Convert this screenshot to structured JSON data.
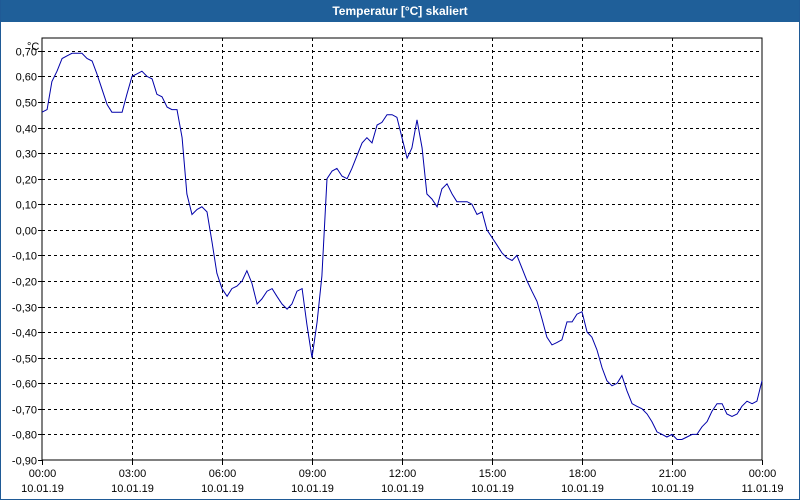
{
  "window": {
    "title": "Temperatur [°C] skaliert"
  },
  "chart_data": {
    "type": "line",
    "title": "Temperatur [°C] skaliert",
    "ylabel": "°C",
    "xlabel": "",
    "ylim": [
      -0.9,
      0.75
    ],
    "xlim": [
      0,
      24
    ],
    "grid": true,
    "y_ticks": [
      "0,70",
      "0,60",
      "0,50",
      "0,40",
      "0,30",
      "0,20",
      "0,10",
      "0,00",
      "-0,10",
      "-0,20",
      "-0,30",
      "-0,40",
      "-0,50",
      "-0,60",
      "-0,70",
      "-0,80",
      "-0,90"
    ],
    "y_tick_values": [
      0.7,
      0.6,
      0.5,
      0.4,
      0.3,
      0.2,
      0.1,
      0.0,
      -0.1,
      -0.2,
      -0.3,
      -0.4,
      -0.5,
      -0.6,
      -0.7,
      -0.8,
      -0.9
    ],
    "x_ticks": [
      {
        "time": "00:00",
        "date": "10.01.19"
      },
      {
        "time": "03:00",
        "date": "10.01.19"
      },
      {
        "time": "06:00",
        "date": "10.01.19"
      },
      {
        "time": "09:00",
        "date": "10.01.19"
      },
      {
        "time": "12:00",
        "date": "10.01.19"
      },
      {
        "time": "15:00",
        "date": "10.01.19"
      },
      {
        "time": "18:00",
        "date": "10.01.19"
      },
      {
        "time": "21:00",
        "date": "10.01.19"
      },
      {
        "time": "00:00",
        "date": "11.01.19"
      }
    ],
    "x_tick_hours": [
      0,
      3,
      6,
      9,
      12,
      15,
      18,
      21,
      24
    ],
    "colors": {
      "line": "#0000aa",
      "grid": "#000000",
      "axis": "#000000"
    },
    "series": [
      {
        "x": [
          0.0,
          0.17,
          0.33,
          0.5,
          0.67,
          0.83,
          1.0,
          1.17,
          1.33,
          1.5,
          1.67,
          1.83,
          2.0,
          2.17,
          2.33,
          2.5,
          2.67,
          2.83,
          3.0,
          3.17,
          3.33,
          3.5,
          3.67,
          3.83,
          4.0,
          4.17,
          4.33,
          4.5,
          4.67,
          4.83,
          5.0,
          5.17,
          5.33,
          5.5,
          5.67,
          5.83,
          6.0,
          6.17,
          6.33,
          6.5,
          6.67,
          6.83,
          7.0,
          7.17,
          7.33,
          7.5,
          7.67,
          7.83,
          8.0,
          8.17,
          8.33,
          8.5,
          8.67,
          8.83,
          9.0,
          9.17,
          9.33,
          9.5,
          9.67,
          9.83,
          10.0,
          10.17,
          10.33,
          10.5,
          10.67,
          10.83,
          11.0,
          11.17,
          11.33,
          11.5,
          11.67,
          11.83,
          12.0,
          12.17,
          12.33,
          12.5,
          12.67,
          12.83,
          13.0,
          13.17,
          13.33,
          13.5,
          13.67,
          13.83,
          14.0,
          14.17,
          14.33,
          14.5,
          14.67,
          14.83,
          15.0,
          15.17,
          15.33,
          15.5,
          15.67,
          15.83,
          16.0,
          16.17,
          16.33,
          16.5,
          16.67,
          16.83,
          17.0,
          17.17,
          17.33,
          17.5,
          17.67,
          17.83,
          18.0,
          18.17,
          18.33,
          18.5,
          18.67,
          18.83,
          19.0,
          19.17,
          19.33,
          19.5,
          19.67,
          19.83,
          20.0,
          20.17,
          20.33,
          20.5,
          20.67,
          20.83,
          21.0,
          21.17,
          21.33,
          21.5,
          21.67,
          21.83,
          22.0,
          22.17,
          22.33,
          22.5,
          22.67,
          22.83,
          23.0,
          23.17,
          23.33,
          23.5,
          23.67,
          23.83,
          24.0
        ],
        "y": [
          0.46,
          0.47,
          0.58,
          0.62,
          0.67,
          0.68,
          0.69,
          0.69,
          0.69,
          0.67,
          0.66,
          0.61,
          0.55,
          0.49,
          0.46,
          0.46,
          0.46,
          0.53,
          0.6,
          0.61,
          0.62,
          0.6,
          0.59,
          0.53,
          0.52,
          0.48,
          0.47,
          0.47,
          0.36,
          0.14,
          0.06,
          0.08,
          0.09,
          0.07,
          -0.05,
          -0.17,
          -0.23,
          -0.26,
          -0.23,
          -0.22,
          -0.2,
          -0.16,
          -0.21,
          -0.29,
          -0.27,
          -0.24,
          -0.23,
          -0.26,
          -0.29,
          -0.31,
          -0.29,
          -0.24,
          -0.23,
          -0.37,
          -0.5,
          -0.36,
          -0.18,
          0.2,
          0.23,
          0.24,
          0.21,
          0.2,
          0.24,
          0.29,
          0.34,
          0.36,
          0.34,
          0.41,
          0.42,
          0.45,
          0.45,
          0.44,
          0.36,
          0.28,
          0.32,
          0.43,
          0.32,
          0.14,
          0.12,
          0.09,
          0.16,
          0.18,
          0.14,
          0.11,
          0.11,
          0.11,
          0.1,
          0.06,
          0.07,
          0.0,
          -0.03,
          -0.06,
          -0.09,
          -0.11,
          -0.12,
          -0.1,
          -0.15,
          -0.2,
          -0.24,
          -0.28,
          -0.35,
          -0.42,
          -0.45,
          -0.44,
          -0.43,
          -0.36,
          -0.36,
          -0.33,
          -0.32,
          -0.4,
          -0.42,
          -0.47,
          -0.54,
          -0.59,
          -0.61,
          -0.6,
          -0.57,
          -0.63,
          -0.68,
          -0.69,
          -0.7,
          -0.72,
          -0.75,
          -0.79,
          -0.8,
          -0.81,
          -0.8,
          -0.82,
          -0.82,
          -0.81,
          -0.8,
          -0.8,
          -0.77,
          -0.75,
          -0.71,
          -0.68,
          -0.68,
          -0.72,
          -0.73,
          -0.72,
          -0.69,
          -0.67,
          -0.68,
          -0.67,
          -0.59
        ]
      }
    ]
  }
}
